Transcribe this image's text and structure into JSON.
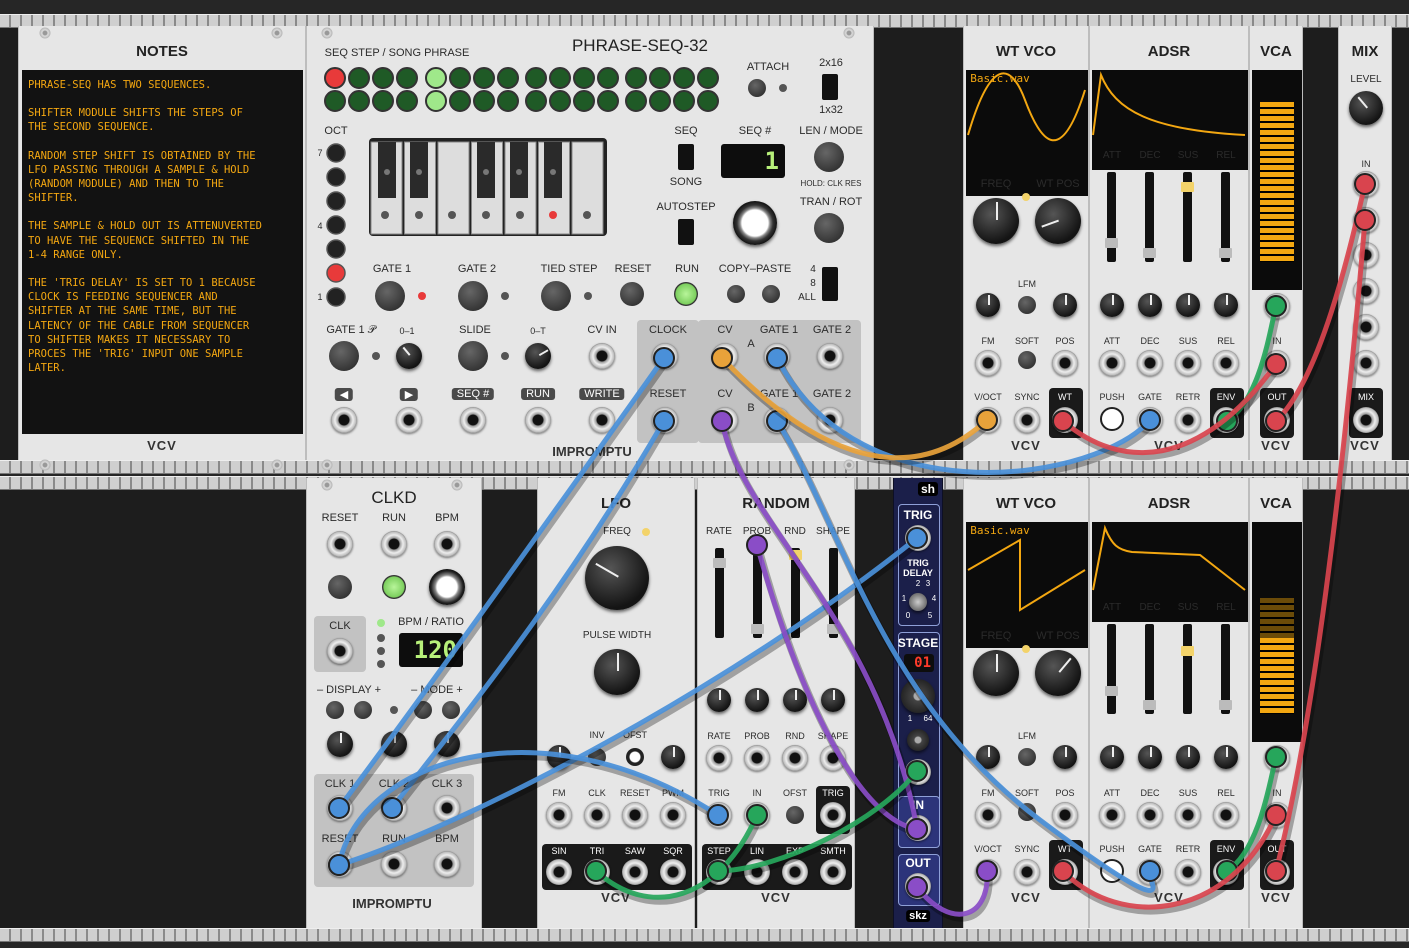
{
  "colors": {
    "cable_blue": "#4a90d9",
    "cable_red": "#d9444e",
    "cable_green": "#26a65b",
    "cable_purple": "#8a4dc7",
    "cable_orange": "#e8a23a",
    "display_amber": "#f3a711",
    "led_green": "#9fe88a",
    "led_red": "#e83a3a"
  },
  "notes": {
    "title": "NOTES",
    "brand": "VCV",
    "paragraphs": [
      "PHRASE-SEQ HAS TWO SEQUENCES.",
      "SHIFTER MODULE SHIFTS THE STEPS OF\nTHE SECOND SEQUENCE.",
      "RANDOM STEP SHIFT IS OBTAINED BY THE\nLFO PASSING THROUGH A SAMPLE & HOLD\n(RANDOM MODULE) AND THEN TO THE\nSHIFTER.",
      "THE SAMPLE & HOLD OUT IS ATTENUVERTED\nTO HAVE THE SEQUENCE SHIFTED IN THE\n1-4 RANGE ONLY.",
      "THE 'TRIG DELAY' IS SET TO 1 BECAUSE\nCLOCK IS FEEDING SEQUENCER AND\nSHIFTER AT THE SAME TIME, BUT THE\nLATENCY OF THE CABLE FROM SEQUENCER\nTO SHIFTER MAKES IT NECESSARY TO\nPROCES THE 'TRIG' INPUT ONE SAMPLE\nLATER."
    ]
  },
  "phraseseq": {
    "title": "PHRASE-SEQ-32",
    "step_label": "SEQ STEP / SONG PHRASE",
    "attach": "ATTACH",
    "mode_top": "2x16",
    "mode_bottom": "1x32",
    "oct": "OCT",
    "oct_nums": [
      "7",
      "4",
      "1"
    ],
    "seq": "SEQ",
    "song": "SONG",
    "seq_num": "SEQ #",
    "seq_display": "1",
    "len_mode": "LEN / MODE",
    "hold": "HOLD: CLK RES",
    "autostep": "AUTOSTEP",
    "tran_rot": "TRAN / ROT",
    "gate1": "GATE 1",
    "gate2": "GATE 2",
    "tied": "TIED STEP",
    "reset": "RESET",
    "run": "RUN",
    "copy_paste": "COPY–PASTE",
    "cp_4": "4",
    "cp_8": "8",
    "cp_all": "ALL",
    "gate1p": "GATE 1 𝒫",
    "range01": "0–1",
    "slide": "SLIDE",
    "range0t": "0–T",
    "cvin": "CV IN",
    "clock": "CLOCK",
    "reset_in": "RESET",
    "cv_a": "CV",
    "gate1_a": "GATE 1",
    "gate2_a": "GATE 2",
    "a": "A",
    "cv_b": "CV",
    "gate1_b": "GATE 1",
    "gate2_b": "GATE 2",
    "b": "B",
    "btn_left": "◀",
    "btn_right": "▶",
    "btn_seq": "SEQ #",
    "btn_run": "RUN",
    "btn_write": "WRITE",
    "brand": "IMPROMPTU"
  },
  "wtvco_top": {
    "title": "WT VCO",
    "wave": "Basic.wav",
    "freq": "FREQ",
    "wtpos": "WT POS",
    "lfm": "LFM",
    "fm": "FM",
    "soft": "SOFT",
    "pos": "POS",
    "voct": "V/OCT",
    "sync": "SYNC",
    "wt": "WT",
    "brand": "VCV"
  },
  "adsr_top": {
    "title": "ADSR",
    "att": "ATT",
    "dec": "DEC",
    "sus": "SUS",
    "rel": "REL",
    "push": "PUSH",
    "gate": "GATE",
    "retr": "RETR",
    "env": "ENV",
    "brand": "VCV"
  },
  "vca_top": {
    "title": "VCA",
    "in": "IN",
    "out": "OUT",
    "brand": "VCV"
  },
  "mix": {
    "title": "MIX",
    "level": "LEVEL",
    "in": "IN",
    "mix": "MIX",
    "brand": "VCV"
  },
  "clkd": {
    "title": "CLKD",
    "reset": "RESET",
    "run": "RUN",
    "bpm": "BPM",
    "clk": "CLK",
    "bpm_ratio": "BPM / RATIO",
    "bpm_value": "120",
    "display": "– DISPLAY +",
    "mode": "– MODE +",
    "clk1": "CLK 1",
    "clk2": "CLK 2",
    "clk3": "CLK 3",
    "reset_out": "RESET",
    "run_out": "RUN",
    "bpm_out": "BPM",
    "brand": "IMPROMPTU"
  },
  "lfo": {
    "title": "LFO",
    "freq": "FREQ",
    "pulse_width": "PULSE WIDTH",
    "inv": "INV",
    "ofst": "OFST",
    "fm": "FM",
    "clk": "CLK",
    "reset": "RESET",
    "pwm": "PWM",
    "sin": "SIN",
    "tri": "TRI",
    "saw": "SAW",
    "sqr": "SQR",
    "brand": "VCV"
  },
  "random": {
    "title": "RANDOM",
    "rate": "RATE",
    "prob": "PROB",
    "rnd": "RND",
    "shape": "SHAPE",
    "ofst": "OFST",
    "trig": "TRIG",
    "in": "IN",
    "step": "STEP",
    "lin": "LIN",
    "exp": "EXP",
    "smth": "SMTH",
    "brand": "VCV"
  },
  "shifter": {
    "logo": "sh",
    "trig": "TRIG",
    "trig_delay": "TRIG\nDELAY",
    "d1": "1",
    "d2": "2",
    "d3": "3",
    "d4": "4",
    "d0": "0",
    "d5": "5",
    "stage": "STAGE",
    "stage_value": "01",
    "stage_min": "1",
    "stage_max": "64",
    "in": "IN",
    "out": "OUT",
    "brand": "skz"
  },
  "wtvco_bot": {
    "title": "WT VCO",
    "wave": "Basic.wav",
    "freq": "FREQ",
    "wtpos": "WT POS",
    "lfm": "LFM",
    "fm": "FM",
    "soft": "SOFT",
    "pos": "POS",
    "voct": "V/OCT",
    "sync": "SYNC",
    "wt": "WT",
    "brand": "VCV"
  },
  "adsr_bot": {
    "title": "ADSR",
    "att": "ATT",
    "dec": "DEC",
    "sus": "SUS",
    "rel": "REL",
    "push": "PUSH",
    "gate": "GATE",
    "retr": "RETR",
    "env": "ENV",
    "brand": "VCV"
  },
  "vca_bot": {
    "title": "VCA",
    "in": "IN",
    "out": "OUT",
    "brand": "VCV"
  }
}
